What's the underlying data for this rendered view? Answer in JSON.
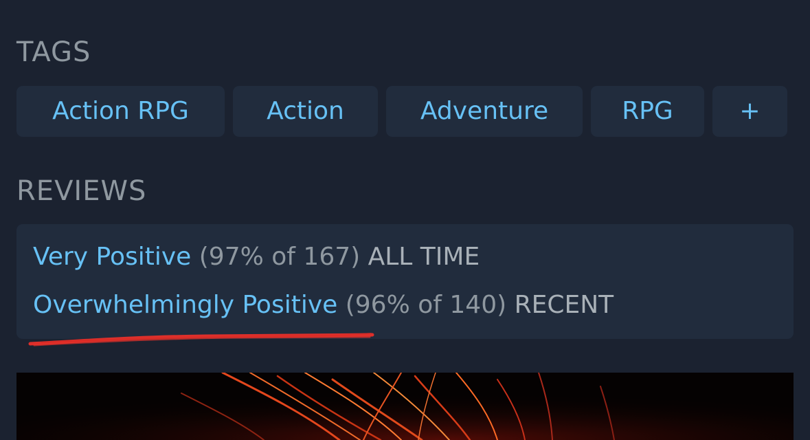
{
  "tags": {
    "heading": "TAGS",
    "items": [
      {
        "label": "Action RPG"
      },
      {
        "label": "Action"
      },
      {
        "label": "Adventure"
      },
      {
        "label": "RPG"
      },
      {
        "label": "+"
      }
    ]
  },
  "reviews": {
    "heading": "REVIEWS",
    "all_time": {
      "summary": "Very Positive",
      "detail": "(97% of 167)",
      "period": "ALL TIME"
    },
    "recent": {
      "summary": "Overwhelmingly Positive",
      "detail": "(96% of 140)",
      "period": "RECENT"
    }
  },
  "colors": {
    "background": "#1b2230",
    "card": "#212c3d",
    "link_blue": "#67c1f5",
    "muted_text": "#8f98a0",
    "annotation_red": "#e8302a"
  }
}
